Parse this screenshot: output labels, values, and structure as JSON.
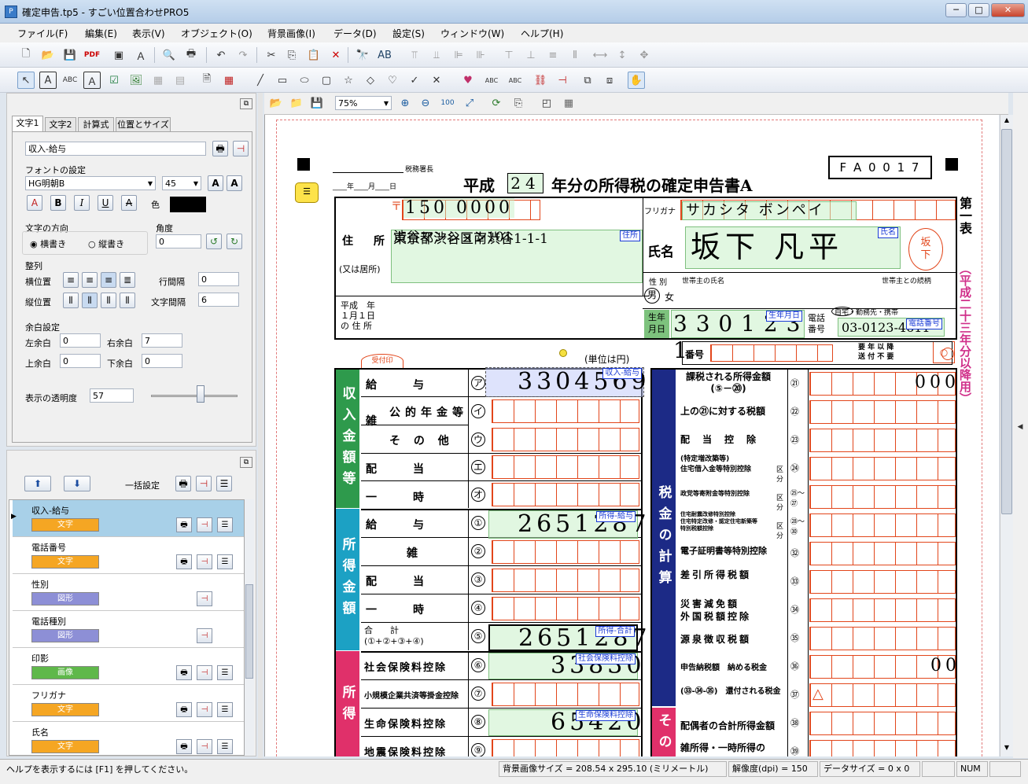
{
  "window": {
    "title": "確定申告.tp5 - すごい位置合わせPRO5",
    "min": "─",
    "max": "□",
    "close": "✕"
  },
  "menu": [
    "ファイル(F)",
    "編集(E)",
    "表示(V)",
    "オブジェクト(O)",
    "背景画像(I)",
    "データ(D)",
    "設定(S)",
    "ウィンドウ(W)",
    "ヘルプ(H)"
  ],
  "props": {
    "tabs": [
      "文字1",
      "文字2",
      "計算式",
      "位置とサイズ"
    ],
    "name": "収入-給与",
    "font_section": "フォントの設定",
    "font_name": "HG明朝B",
    "font_size": "45",
    "color_label": "色",
    "direction_label": "文字の方向",
    "horizontal": "横書き",
    "vertical": "縦書き",
    "angle_label": "角度",
    "angle": "0",
    "align_section": "整列",
    "h_align": "横位置",
    "v_align": "縦位置",
    "line_spacing_label": "行間隔",
    "line_spacing": "0",
    "char_spacing_label": "文字間隔",
    "char_spacing": "6",
    "margin_section": "余白設定",
    "left_margin_label": "左余白",
    "left_margin": "0",
    "right_margin_label": "右余白",
    "right_margin": "7",
    "top_margin_label": "上余白",
    "top_margin": "0",
    "bottom_margin_label": "下余白",
    "bottom_margin": "0",
    "opacity_label": "表示の透明度",
    "opacity": "57",
    "opacity_level": 0.57
  },
  "list": {
    "bulk_label": "一括設定",
    "items": [
      {
        "name": "収入-給与",
        "type": "文字",
        "color": "#f5a623"
      },
      {
        "name": "電話番号",
        "type": "文字",
        "color": "#f5a623"
      },
      {
        "name": "性別",
        "type": "図形",
        "color": "#8d8fd6"
      },
      {
        "name": "電話種別",
        "type": "図形",
        "color": "#8d8fd6"
      },
      {
        "name": "印影",
        "type": "画像",
        "color": "#5fb84a"
      },
      {
        "name": "フリガナ",
        "type": "文字",
        "color": "#f5a623"
      },
      {
        "name": "氏名",
        "type": "文字",
        "color": "#f5a623"
      }
    ]
  },
  "canvas": {
    "zoom": "75%"
  },
  "form": {
    "code": "F A 0 0 1 7",
    "office": "税務署長",
    "date_line": "____年____月____日",
    "title_pre": "平成",
    "year": "24",
    "title_post": "年分の所得税の確定申告書A",
    "side_title": "第一表",
    "side_note": "（平成二十三年分以降用）",
    "postal_mark": "〒",
    "postal": "150 0000",
    "address_label": "住　所",
    "address_sub": "(又は居所)",
    "address1": "東京都渋谷区南渋谷1-1-1",
    "address2": "渋谷マンション101",
    "addr_tag": "住所",
    "prev_addr": "平成　年\n１月１日\nの 住 所",
    "furigana_label": "フリガナ",
    "furigana": "サカシタ ボンペイ",
    "name_label": "氏名",
    "name": "坂下 凡平",
    "name_tag": "氏名",
    "seal": "坂\n下",
    "gender_label": "性 別",
    "male": "男",
    "female": "女",
    "householder": "世帯主の氏名",
    "relation": "世帯主との続柄",
    "birth_label": "生年\n月日",
    "birth": "3 3 0 1 2 3 1",
    "birth_tag": "生年月日",
    "phone_label": "電話\n番号",
    "phone_type": "自宅・勤務先・携帯",
    "phone": "03-0123-4611",
    "phone_tag": "電話番号",
    "number_label": "番号",
    "unit": "(単位は円)",
    "receipt": "受付印",
    "seiri": "整理番号",
    "yoko": "要 年 以 降\n送 付 不 要",
    "income_section": "収入金額等",
    "income_rows": [
      {
        "label": "給　　与",
        "mark": "ア"
      },
      {
        "label": "公的年金等",
        "mark": "イ"
      },
      {
        "label": "そ の 他",
        "mark": "ウ"
      },
      {
        "label": "配　　当",
        "mark": "エ"
      },
      {
        "label": "一　　時",
        "mark": "オ"
      }
    ],
    "zatsu": "雑",
    "income_value": "3304569",
    "income_tag": "収入-給与",
    "shotoku_section": "所得金額",
    "shotoku_rows": [
      {
        "label": "給　　与",
        "mark": "①"
      },
      {
        "label": "雑",
        "mark": "②"
      },
      {
        "label": "配　　当",
        "mark": "③"
      },
      {
        "label": "一　　時",
        "mark": "④"
      },
      {
        "label": "合　　計\n(①+②+③+④)",
        "mark": "⑤"
      }
    ],
    "shotoku_value": "2651287",
    "shotoku_tag": "所得-給与",
    "total_value": "2651287",
    "total_tag": "所得-合計",
    "deduct_section": "所得",
    "deduct_rows": [
      {
        "label": "社会保険料控除",
        "mark": "⑥",
        "value": "33830",
        "tag": "社会保険料控除"
      },
      {
        "label": "小規模企業共済等掛金控除",
        "mark": "⑦",
        "value": "",
        "tag": ""
      },
      {
        "label": "生命保険料控除",
        "mark": "⑧",
        "value": "65420",
        "tag": "生命保険料控除"
      },
      {
        "label": "地震保険料控除",
        "mark": "⑨",
        "value": "",
        "tag": ""
      }
    ],
    "tax_section": "税金の計算",
    "tax_rows": [
      {
        "label": "課税される所得金額\n(⑤－⑳)",
        "mark": "㉑",
        "value": "000"
      },
      {
        "label": "上の㉑に対する税額",
        "mark": "㉒",
        "value": ""
      },
      {
        "label": "配　当　控　除",
        "mark": "㉓",
        "value": ""
      },
      {
        "label": "(特定増改築等)\n住宅借入金等特別控除",
        "mark": "㉔",
        "value": ""
      },
      {
        "label": "政党等寄附金等特別控除",
        "mark": "㉕〜㉗",
        "value": ""
      },
      {
        "label": "住宅耐震改修特別控除\n住宅特定改修・認定住宅新築等\n特別税額控除",
        "mark": "㉘〜㉚",
        "value": ""
      },
      {
        "label": "電子証明書等特別控除",
        "mark": "㉜",
        "value": ""
      },
      {
        "label": "差引所得税額",
        "mark": "㉝",
        "value": ""
      },
      {
        "label": "災害減免額\n外国税額控除",
        "mark": "㉞",
        "value": ""
      },
      {
        "label": "源泉徴収税額",
        "mark": "㉟",
        "value": ""
      },
      {
        "label": "申告納税額　納める税金",
        "mark": "㊱",
        "value": "00"
      },
      {
        "label": "(㉝-㉞-㉟)　還付される税金",
        "mark": "㊲",
        "value": "△"
      },
      {
        "label": "配偶者の合計所得金額",
        "mark": "㊳",
        "value": ""
      },
      {
        "label": "雑所得・一時所得の",
        "mark": "㊴",
        "value": ""
      }
    ],
    "kubun": "区\n分",
    "other_section": "その"
  },
  "status": {
    "help": "ヘルプを表示するには [F1] を押してください。",
    "bg_size": "背景画像サイズ = 208.54 x 295.10 (ミリメートル)",
    "dpi": "解像度(dpi) = 150",
    "data_size": "データサイズ = 0 x 0",
    "num": "NUM"
  }
}
